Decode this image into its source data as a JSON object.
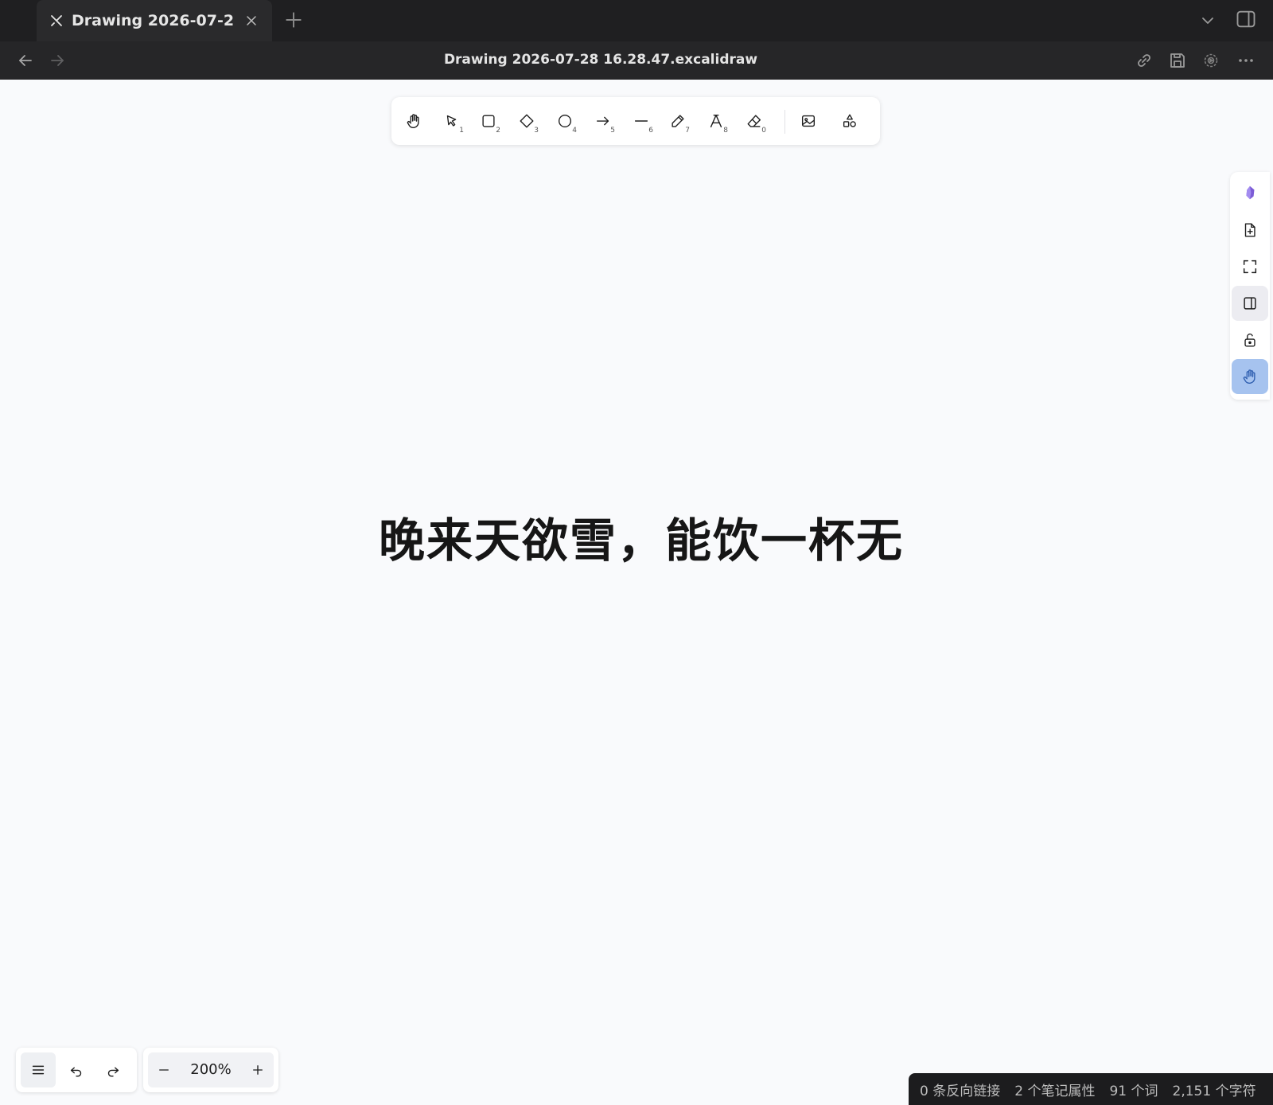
{
  "tab": {
    "title": "Drawing 2026-07-2..."
  },
  "header": {
    "title": "Drawing 2026-07-28 16.28.47.excalidraw"
  },
  "toolbar": {
    "tools": [
      {
        "name": "hand",
        "num": ""
      },
      {
        "name": "selection",
        "num": "1"
      },
      {
        "name": "rectangle",
        "num": "2"
      },
      {
        "name": "diamond",
        "num": "3"
      },
      {
        "name": "ellipse",
        "num": "4"
      },
      {
        "name": "arrow",
        "num": "5"
      },
      {
        "name": "line",
        "num": "6"
      },
      {
        "name": "draw",
        "num": "7"
      },
      {
        "name": "text",
        "num": "8"
      },
      {
        "name": "eraser",
        "num": "0"
      }
    ]
  },
  "canvas": {
    "text": "晚来天欲雪，能饮一杯无"
  },
  "zoom": {
    "value": "200%"
  },
  "status": {
    "backlinks": "0 条反向链接",
    "properties": "2 个笔记属性",
    "words": "91 个词",
    "chars": "2,151 个字符"
  },
  "colors": {
    "accent_blue": "#a6c3ef",
    "obsidian_purple": "#7c5cd6",
    "dark_bar": "#1f1f21"
  }
}
